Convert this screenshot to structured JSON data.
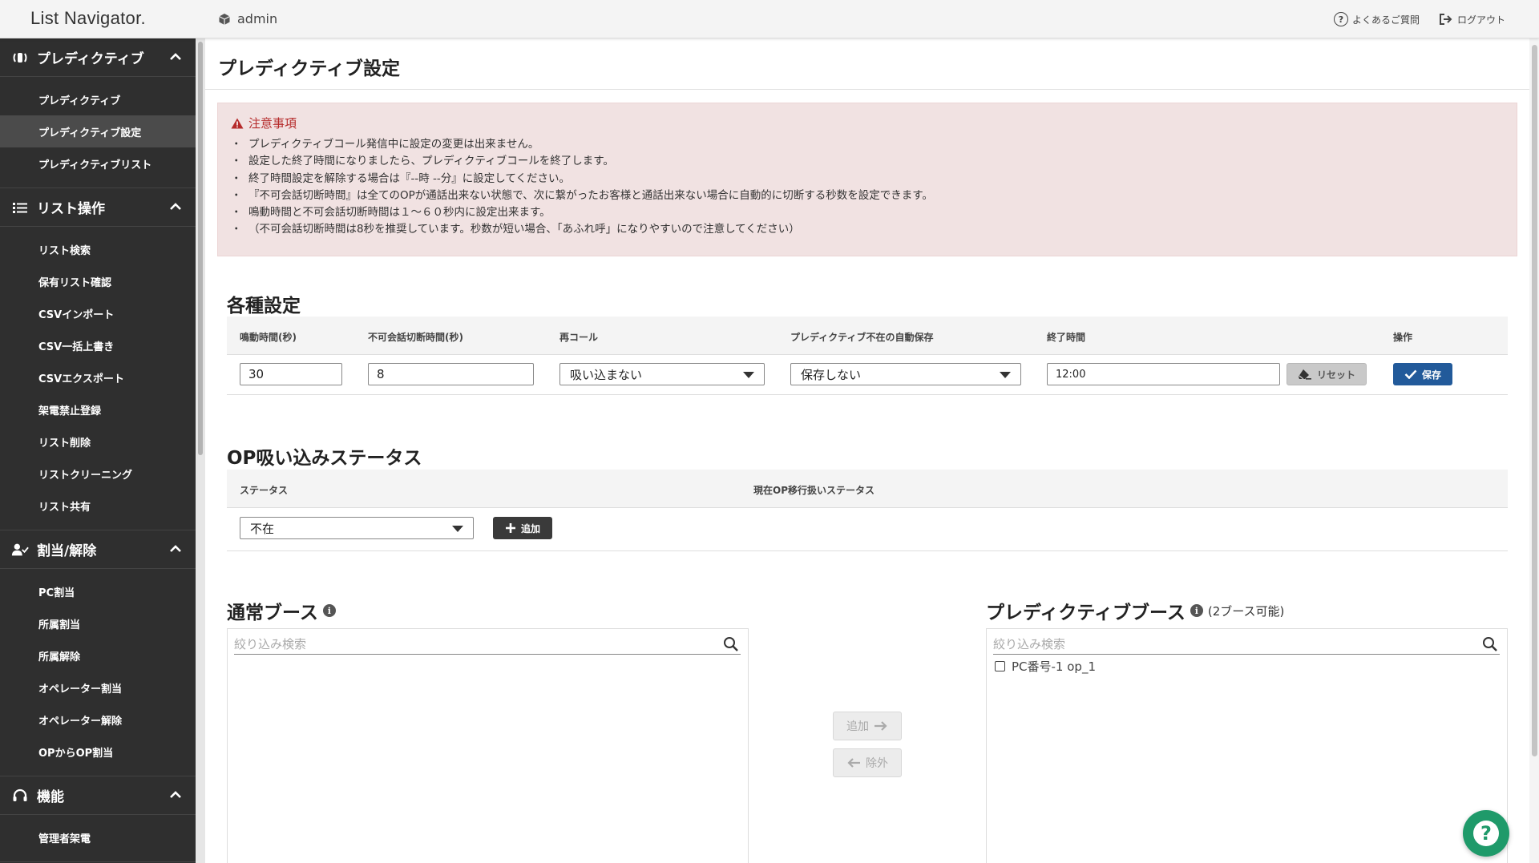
{
  "header": {
    "logo": "List Navigator.",
    "user": "admin",
    "faq": "よくあるご質問",
    "logout": "ログアウト"
  },
  "sidebar": {
    "sections": [
      {
        "title": "プレディクティブ",
        "icon": "phone-ringing-icon",
        "items": [
          "プレディクティブ",
          "プレディクティブ設定",
          "プレディクティブリスト"
        ]
      },
      {
        "title": "リスト操作",
        "icon": "list-icon",
        "items": [
          "リスト検索",
          "保有リスト確認",
          "CSVインポート",
          "CSV一括上書き",
          "CSVエクスポート",
          "架電禁止登録",
          "リスト削除",
          "リストクリーニング",
          "リスト共有"
        ]
      },
      {
        "title": "割当/解除",
        "icon": "user-check-icon",
        "items": [
          "PC割当",
          "所属割当",
          "所属解除",
          "オペレーター割当",
          "オペレーター解除",
          "OPからOP割当"
        ]
      },
      {
        "title": "機能",
        "icon": "headset-icon",
        "items": [
          "管理者架電"
        ]
      }
    ],
    "active_item": "プレディクティブ設定"
  },
  "page": {
    "title": "プレディクティブ設定"
  },
  "notice": {
    "title": "注意事項",
    "lines": [
      "プレディクティブコール発信中に設定の変更は出来ません。",
      "設定した終了時間になりましたら、プレディクティブコールを終了します。",
      "終了時間設定を解除する場合は『--時 --分』に設定してください。",
      "『不可会話切断時間』は全てのOPが通話出来ない状態で、次に繋がったお客様と通話出来ない場合に自動的に切断する秒数を設定できます。",
      "鳴動時間と不可会話切断時間は１～６０秒内に設定出来ます。",
      "（不可会話切断時間は8秒を推奨しています。秒数が短い場合、「あふれ呼」になりやすいので注意してください）"
    ]
  },
  "settings": {
    "heading": "各種設定",
    "columns": [
      "鳴動時間(秒)",
      "不可会話切断時間(秒)",
      "再コール",
      "プレディクティブ不在の自動保存",
      "終了時間",
      "操作"
    ],
    "ring_time": "30",
    "cut_time": "8",
    "recall": "吸い込まない",
    "auto_save": "保存しない",
    "end_time": "12:00",
    "reset_label": "リセット",
    "save_label": "保存"
  },
  "op_status": {
    "heading": "OP吸い込みステータス",
    "columns": [
      "ステータス",
      "現在OP移行扱いステータス"
    ],
    "status_value": "不在",
    "add_label": "追加"
  },
  "booths": {
    "normal_heading": "通常ブース",
    "predictive_heading": "プレディクティブブース",
    "predictive_note": "(2ブース可能)",
    "search_placeholder": "絞り込み検索",
    "predictive_items": [
      "PC番号-1 op_1"
    ],
    "add_label": "追加",
    "remove_label": "除外"
  }
}
